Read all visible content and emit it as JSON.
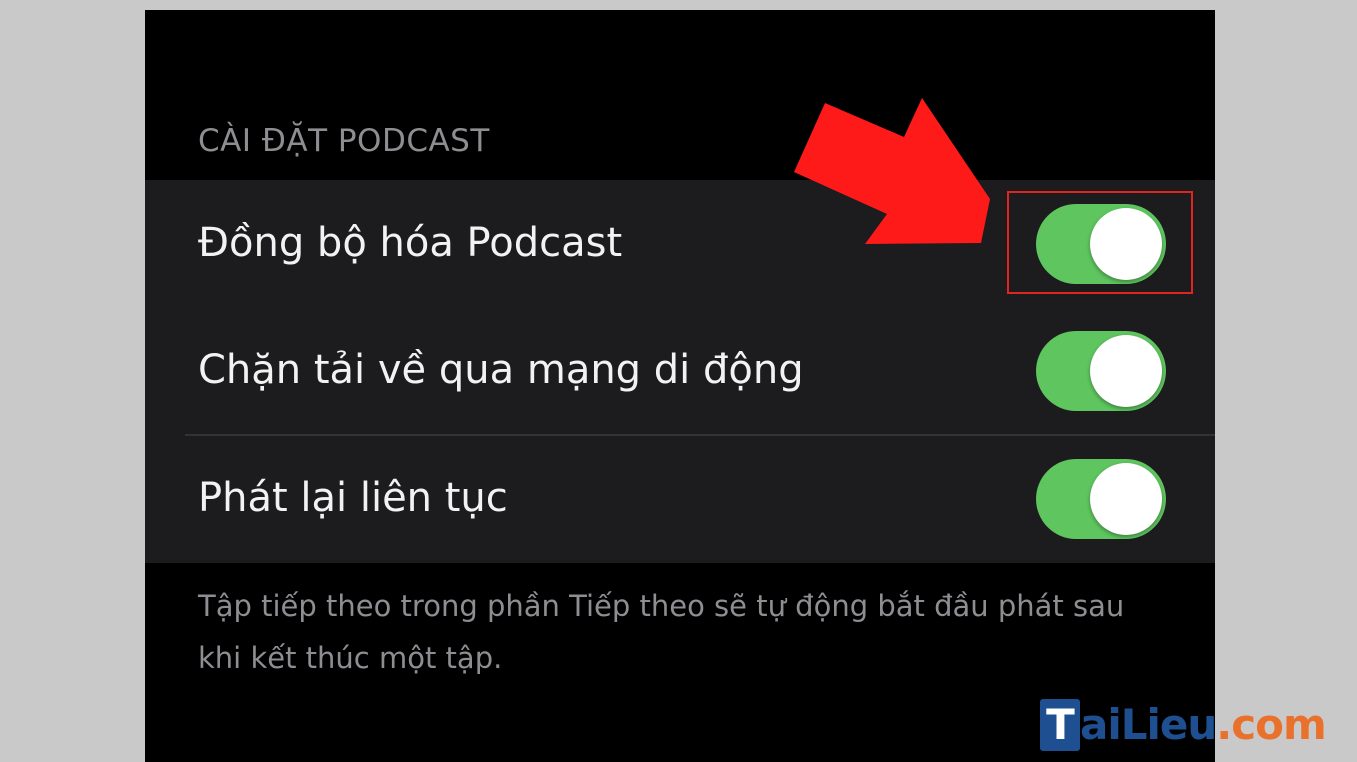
{
  "section_header": "CÀI ĐẶT PODCAST",
  "rows": [
    {
      "label": "Đồng bộ hóa Podcast",
      "toggle_on": true
    },
    {
      "label": "Chặn tải về qua mạng di động",
      "toggle_on": true
    },
    {
      "label": "Phát lại liên tục",
      "toggle_on": true
    }
  ],
  "footer_note": "Tập tiếp theo trong phần Tiếp theo sẽ tự động bắt đầu phát sau khi kết thúc một tập.",
  "annotation": {
    "arrow_color": "#ff1a1a",
    "highlight_color": "#e0241f"
  },
  "watermark": {
    "t": "T",
    "ai": "ai",
    "lieu": "Lieu",
    "com": ".com"
  },
  "colors": {
    "toggle_on": "#5fc65f",
    "background": "#000000",
    "group_background": "#1c1c1e",
    "secondary_text": "#8d8d92"
  }
}
